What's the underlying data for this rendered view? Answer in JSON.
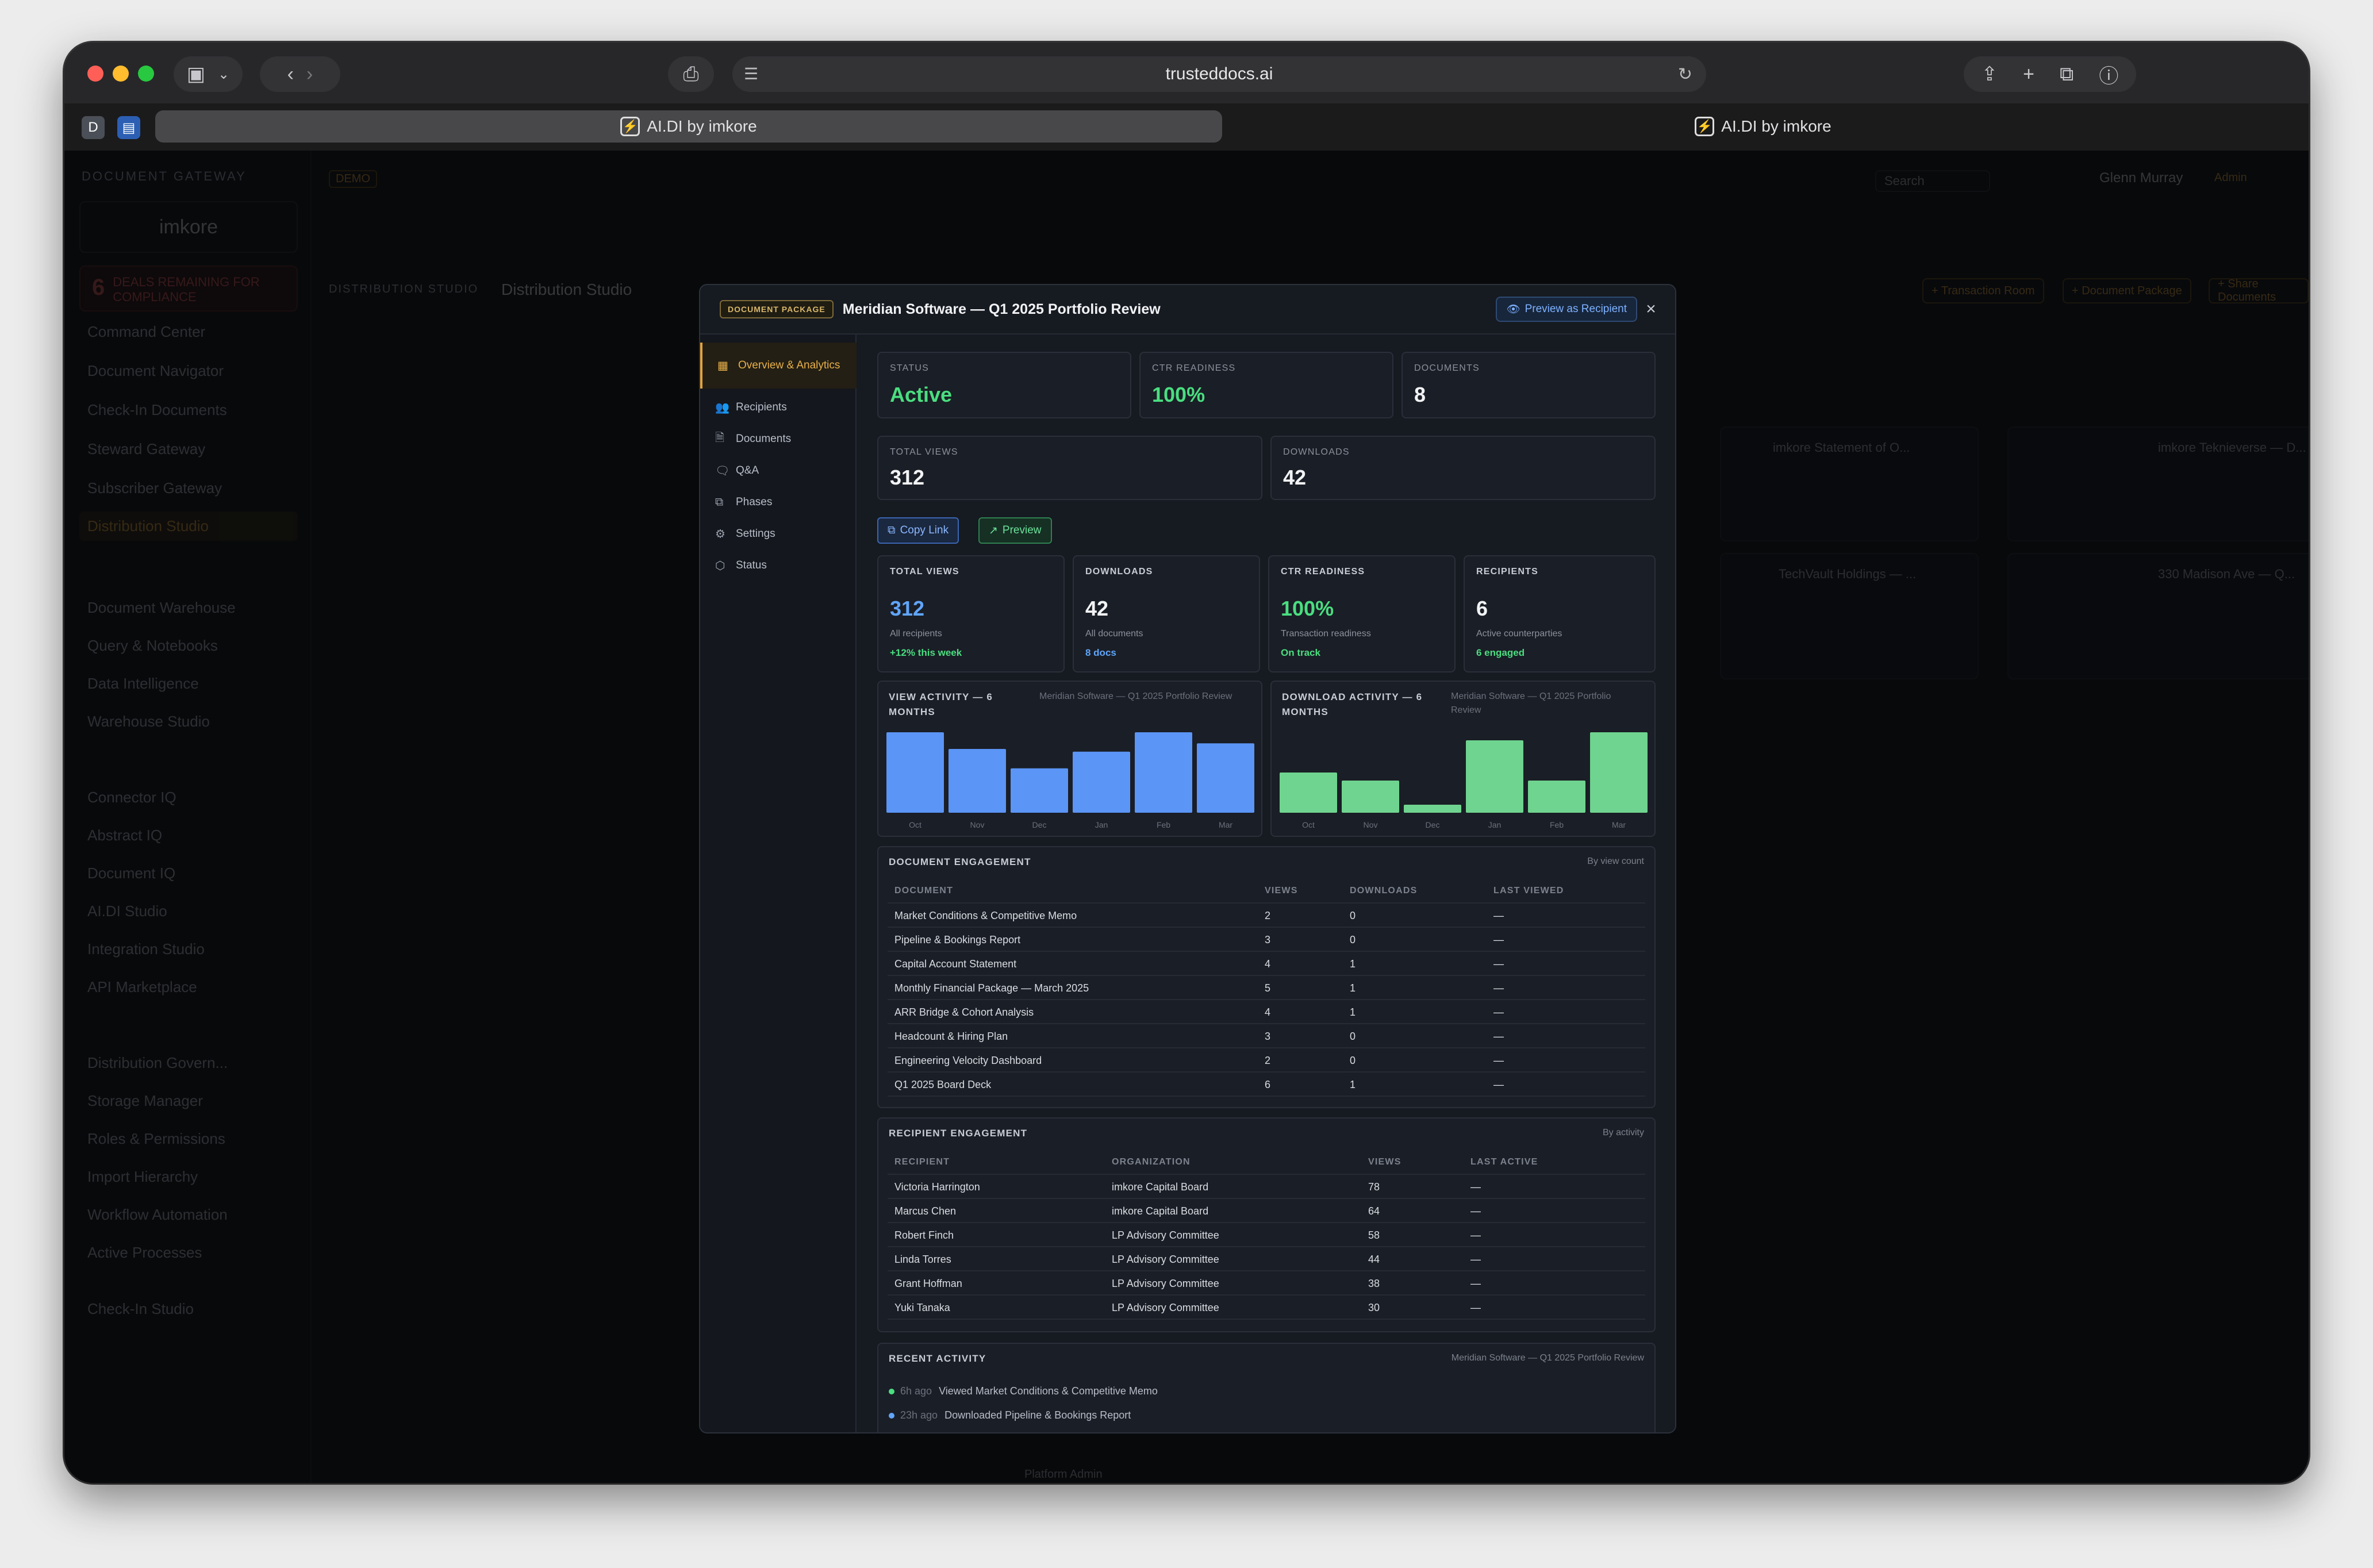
{
  "browser": {
    "url": "trusteddocs.ai",
    "tabs": [
      {
        "label": "AI.DI by imkore"
      },
      {
        "label": "AI.DI by imkore"
      }
    ],
    "profile_initial": "D"
  },
  "background_app": {
    "header": "DOCUMENT GATEWAY",
    "demo_badge": "DEMO",
    "brand": "imkore",
    "alert_count": "6",
    "alert_text": "DEALS REMAINING FOR COMPLIANCE",
    "nav": [
      "Command Center",
      "Document Navigator",
      "Check-In Documents",
      "Steward Gateway",
      "Subscriber Gateway",
      "Distribution Studio",
      "Document Warehouse",
      "Query & Notebooks",
      "Data Intelligence",
      "Warehouse Studio",
      "Connector IQ",
      "Abstract IQ",
      "Document IQ",
      "AI.DI Studio",
      "Integration Studio",
      "API Marketplace",
      "Distribution Govern...",
      "Storage Manager",
      "Roles & Permissions",
      "Import Hierarchy",
      "Workflow Automation",
      "Active Processes",
      "Check-In Studio"
    ],
    "breadcrumb": "DISTRIBUTION STUDIO",
    "page_title": "Distribution Studio",
    "buttons": [
      "+ Transaction Room",
      "+ Document Package",
      "+ Share Documents"
    ],
    "user_name": "Glenn Murray",
    "user_role": "Admin",
    "search_placeholder": "Search",
    "cards": [
      "imkore Statement of O...",
      "imkore Teknieverse — D...",
      "TechVault Holdings — ...",
      "330 Madison Ave — Q..."
    ],
    "footer": "Platform Admin"
  },
  "modal": {
    "badge": "DOCUMENT PACKAGE",
    "title": "Meridian Software — Q1 2025 Portfolio Review",
    "preview_button": "Preview as Recipient",
    "close": "×",
    "nav": [
      {
        "label": "Overview & Analytics",
        "icon": "grid-icon",
        "glyph": "▦"
      },
      {
        "label": "Recipients",
        "icon": "users-icon",
        "glyph": "👥"
      },
      {
        "label": "Documents",
        "icon": "document-icon",
        "glyph": "🗎"
      },
      {
        "label": "Q&A",
        "icon": "chat-icon",
        "glyph": "🗨"
      },
      {
        "label": "Phases",
        "icon": "phases-icon",
        "glyph": "⧉"
      },
      {
        "label": "Settings",
        "icon": "gear-icon",
        "glyph": "⚙"
      },
      {
        "label": "Status",
        "icon": "shield-icon",
        "glyph": "⬡"
      }
    ],
    "summary": [
      {
        "label": "STATUS",
        "value": "Active",
        "accent": "green"
      },
      {
        "label": "CTR READINESS",
        "value": "100%",
        "accent": "green"
      },
      {
        "label": "DOCUMENTS",
        "value": "8",
        "accent": "white"
      },
      {
        "label": "TOTAL VIEWS",
        "value": "312",
        "accent": "white"
      },
      {
        "label": "DOWNLOADS",
        "value": "42",
        "accent": "white"
      }
    ],
    "copy_link": "Copy Link",
    "preview": "Preview",
    "kpis": [
      {
        "label": "TOTAL VIEWS",
        "value": "312",
        "sub": "All recipients",
        "note": "+12% this week",
        "color": "#60a5fa",
        "note_color": "#4ade80"
      },
      {
        "label": "DOWNLOADS",
        "value": "42",
        "sub": "All documents",
        "note": "8 docs",
        "color": "#f2f3f5",
        "note_color": "#60a5fa"
      },
      {
        "label": "CTR READINESS",
        "value": "100%",
        "sub": "Transaction readiness",
        "note": "On track",
        "color": "#4ade80",
        "note_color": "#4ade80"
      },
      {
        "label": "RECIPIENTS",
        "value": "6",
        "sub": "Active counterparties",
        "note": "6 engaged",
        "color": "#f2f3f5",
        "note_color": "#4ade80"
      }
    ],
    "view_chart": {
      "title": "VIEW ACTIVITY — 6 MONTHS",
      "subtitle": "Meridian Software — Q1 2025 Portfolio Review"
    },
    "download_chart": {
      "title": "DOWNLOAD ACTIVITY — 6 MONTHS",
      "subtitle": "Meridian Software — Q1 2025 Portfolio Review"
    },
    "doc_engagement": {
      "title": "DOCUMENT ENGAGEMENT",
      "sub": "By view count",
      "headers": [
        "DOCUMENT",
        "VIEWS",
        "DOWNLOADS",
        "LAST VIEWED"
      ],
      "rows": [
        [
          "Market Conditions & Competitive Memo",
          "2",
          "0",
          "—"
        ],
        [
          "Pipeline & Bookings Report",
          "3",
          "0",
          "—"
        ],
        [
          "Capital Account Statement",
          "4",
          "1",
          "—"
        ],
        [
          "Monthly Financial Package — March 2025",
          "5",
          "1",
          "—"
        ],
        [
          "ARR Bridge & Cohort Analysis",
          "4",
          "1",
          "—"
        ],
        [
          "Headcount & Hiring Plan",
          "3",
          "0",
          "—"
        ],
        [
          "Engineering Velocity Dashboard",
          "2",
          "0",
          "—"
        ],
        [
          "Q1 2025 Board Deck",
          "6",
          "1",
          "—"
        ]
      ]
    },
    "recipient_engagement": {
      "title": "RECIPIENT ENGAGEMENT",
      "sub": "By activity",
      "headers": [
        "RECIPIENT",
        "ORGANIZATION",
        "VIEWS",
        "LAST ACTIVE"
      ],
      "rows": [
        [
          "Victoria Harrington",
          "imkore Capital Board",
          "78",
          "—"
        ],
        [
          "Marcus Chen",
          "imkore Capital Board",
          "64",
          "—"
        ],
        [
          "Robert Finch",
          "LP Advisory Committee",
          "58",
          "—"
        ],
        [
          "Linda Torres",
          "LP Advisory Committee",
          "44",
          "—"
        ],
        [
          "Grant Hoffman",
          "LP Advisory Committee",
          "38",
          "—"
        ],
        [
          "Yuki Tanaka",
          "LP Advisory Committee",
          "30",
          "—"
        ]
      ]
    },
    "recent_activity": {
      "title": "RECENT ACTIVITY",
      "sub": "Meridian Software — Q1 2025 Portfolio Review",
      "items": [
        {
          "ago": "6h ago",
          "text": "Viewed Market Conditions & Competitive Memo",
          "color": "#4ade80"
        },
        {
          "ago": "23h ago",
          "text": "Downloaded Pipeline & Bookings Report",
          "color": "#60a5fa"
        }
      ]
    }
  },
  "chart_data": [
    {
      "type": "bar",
      "categories": [
        "Oct",
        "Nov",
        "Dec",
        "Jan",
        "Feb",
        "Mar"
      ],
      "values": [
        58,
        46,
        32,
        44,
        58,
        50
      ],
      "color": "#5b95f5"
    },
    {
      "type": "bar",
      "categories": [
        "Oct",
        "Nov",
        "Dec",
        "Jan",
        "Feb",
        "Mar"
      ],
      "values": [
        5,
        4,
        1,
        9,
        4,
        10
      ],
      "color": "#6fd48f"
    }
  ]
}
